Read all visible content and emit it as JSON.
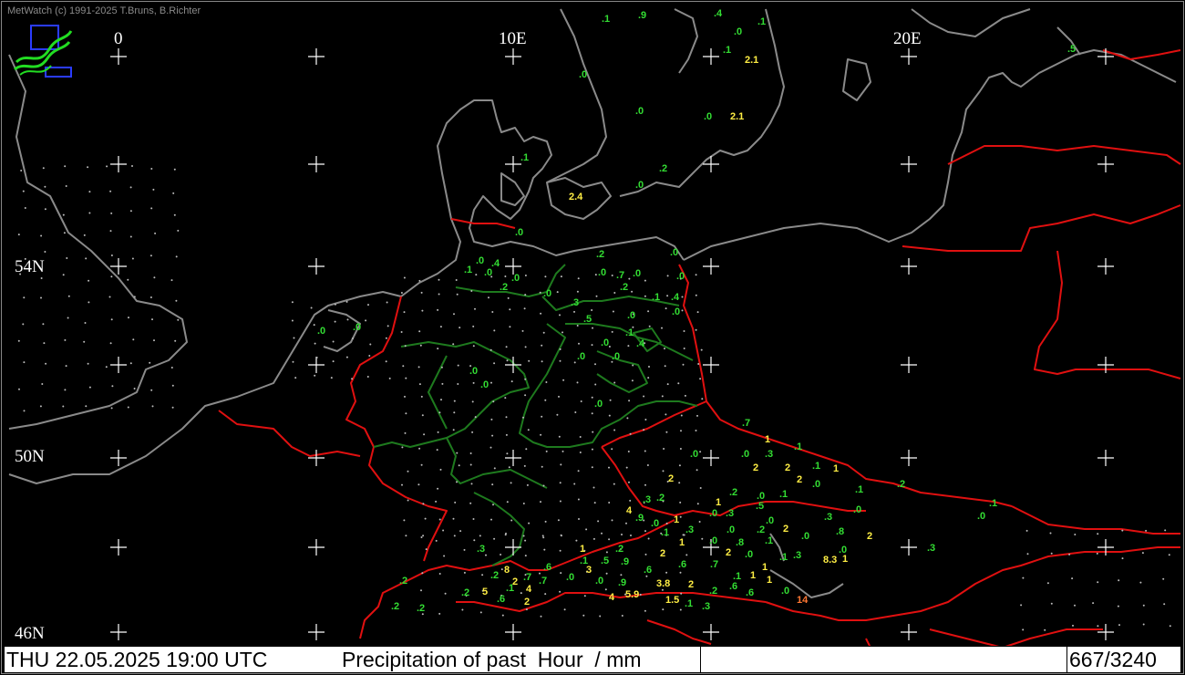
{
  "credit": "MetWatch  (c) 1991-2025 T.Bruns, B.Richter",
  "logo_icon": "metwatch-logo-icon",
  "lon_labels": [
    "0",
    "10E",
    "20E"
  ],
  "lat_labels": [
    "54N",
    "50N",
    "46N"
  ],
  "footer": {
    "datetime": "THU 22.05.2025 19:00 UTC",
    "title": "Precipitation of past  Hour  / mm",
    "count": "667/3240"
  },
  "colors": {
    "background": "#000000",
    "coast": "#8a8a8a",
    "border": "#e01010",
    "states": "#1e7a1e",
    "obs_low": "#33dd33",
    "obs_mid": "#ffee44",
    "obs_high": "#ff7733"
  },
  "observations": [
    ".9",
    ".1",
    ".4",
    ".1",
    ".0",
    ".1",
    ".0",
    "2.1",
    ".0",
    ".0",
    "2.1",
    ".5",
    ".2",
    ".0",
    ".1",
    "2.4",
    ".0",
    ".0",
    ".2",
    ".0",
    ".4",
    ".1",
    ".0",
    ".0",
    ".2",
    ".0",
    ".7",
    ".0",
    ".0",
    ".2",
    ".0",
    ".1",
    ".4",
    ".3",
    ".5",
    ".0",
    ".0",
    ".1",
    ".0",
    ".4",
    ".0",
    ".0",
    ".0",
    ".0",
    ".0",
    ".0",
    ".0",
    ".7",
    "1",
    ".1",
    ".0",
    ".0",
    ".3",
    "2",
    "2",
    ".1",
    "1",
    "2",
    ".0",
    "2",
    ".1",
    ".2",
    ".0",
    ".1",
    ".2",
    "1",
    ".5",
    ".3",
    ".0",
    ".0",
    ".3",
    ".2",
    ".3",
    "4",
    ".0",
    ".9",
    ".0",
    "1",
    ".1",
    ".3",
    ".0",
    ".2",
    "2",
    ".8",
    "2",
    "1",
    ".0",
    ".8",
    ".1",
    ".0",
    ".1",
    ".0",
    ".3",
    ".1",
    ".3",
    ".0",
    "1",
    "8.3",
    ".2",
    "1",
    "2",
    ".0",
    "1",
    ".5",
    ".9",
    ".6",
    "2",
    ".7",
    ".6",
    ".6",
    ".1",
    ".0",
    "3",
    ".9",
    ".0",
    ".7",
    ".7",
    "4",
    ".1",
    ".6",
    "5",
    "2",
    "2",
    ".2",
    ".3",
    ".2",
    "8",
    "3.8",
    "5.9",
    "4",
    "2",
    ".2",
    ".6",
    "1",
    "1",
    ".1",
    ".6",
    ".0",
    "14",
    "1.5",
    ".1",
    ".3",
    ".2",
    ".2",
    ".2"
  ]
}
